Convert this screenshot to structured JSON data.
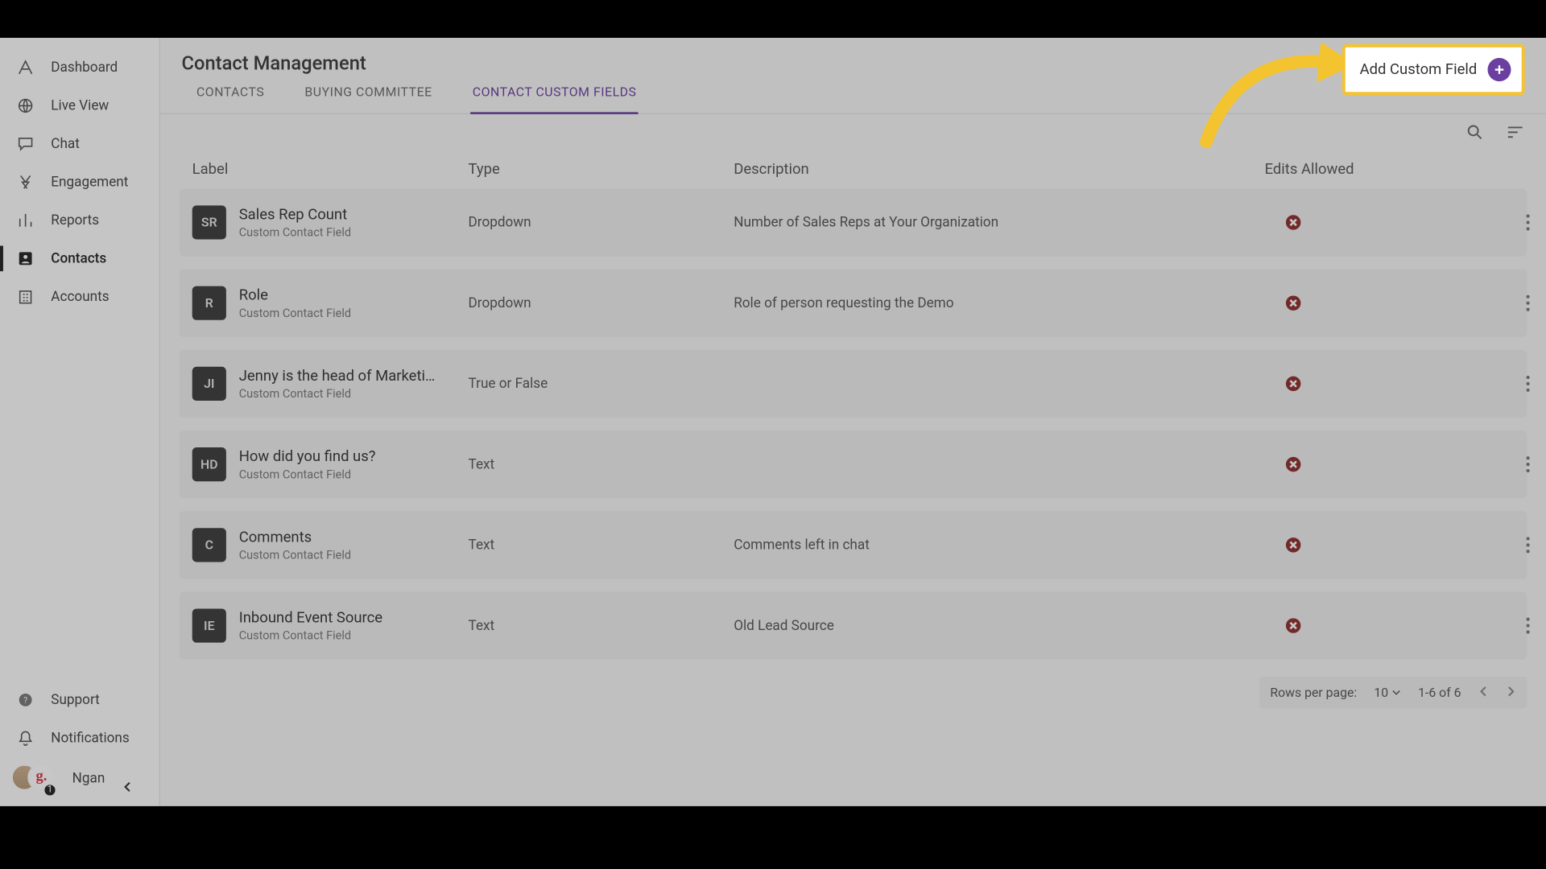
{
  "sidebar": {
    "top_items": [
      {
        "label": "Dashboard",
        "icon": "logo"
      },
      {
        "label": "Live View",
        "icon": "globe"
      },
      {
        "label": "Chat",
        "icon": "chat"
      },
      {
        "label": "Engagement",
        "icon": "spark"
      },
      {
        "label": "Reports",
        "icon": "bars"
      },
      {
        "label": "Contacts",
        "icon": "person",
        "active": true
      },
      {
        "label": "Accounts",
        "icon": "building"
      }
    ],
    "bottom_items": [
      {
        "label": "Support",
        "icon": "help"
      },
      {
        "label": "Notifications",
        "icon": "bell"
      }
    ],
    "user": {
      "name": "Ngan",
      "badge": "1",
      "glyph": "g."
    }
  },
  "header": {
    "title": "Contact Management",
    "tabs": [
      {
        "label": "CONTACTS"
      },
      {
        "label": "BUYING COMMITTEE"
      },
      {
        "label": "CONTACT CUSTOM FIELDS",
        "active": true
      }
    ],
    "add_button": "Add Custom Field"
  },
  "table": {
    "columns": [
      "Label",
      "Type",
      "Description",
      "Edits Allowed"
    ],
    "subtype_label": "Custom Contact Field",
    "rows": [
      {
        "initials": "SR",
        "label": "Sales Rep Count",
        "type": "Dropdown",
        "desc": "Number of Sales Reps at Your Organization",
        "edits": false
      },
      {
        "initials": "R",
        "label": "Role",
        "type": "Dropdown",
        "desc": "Role of person requesting the Demo",
        "edits": false
      },
      {
        "initials": "JI",
        "label": "Jenny is the head of Marketi…",
        "type": "True or False",
        "desc": "",
        "edits": false
      },
      {
        "initials": "HD",
        "label": "How did you find us?",
        "type": "Text",
        "desc": "",
        "edits": false
      },
      {
        "initials": "C",
        "label": "Comments",
        "type": "Text",
        "desc": "Comments left in chat",
        "edits": false
      },
      {
        "initials": "IE",
        "label": "Inbound Event Source",
        "type": "Text",
        "desc": "Old Lead Source",
        "edits": false
      }
    ]
  },
  "pagination": {
    "rows_label": "Rows per page:",
    "rows_value": "10",
    "range": "1-6 of 6"
  }
}
